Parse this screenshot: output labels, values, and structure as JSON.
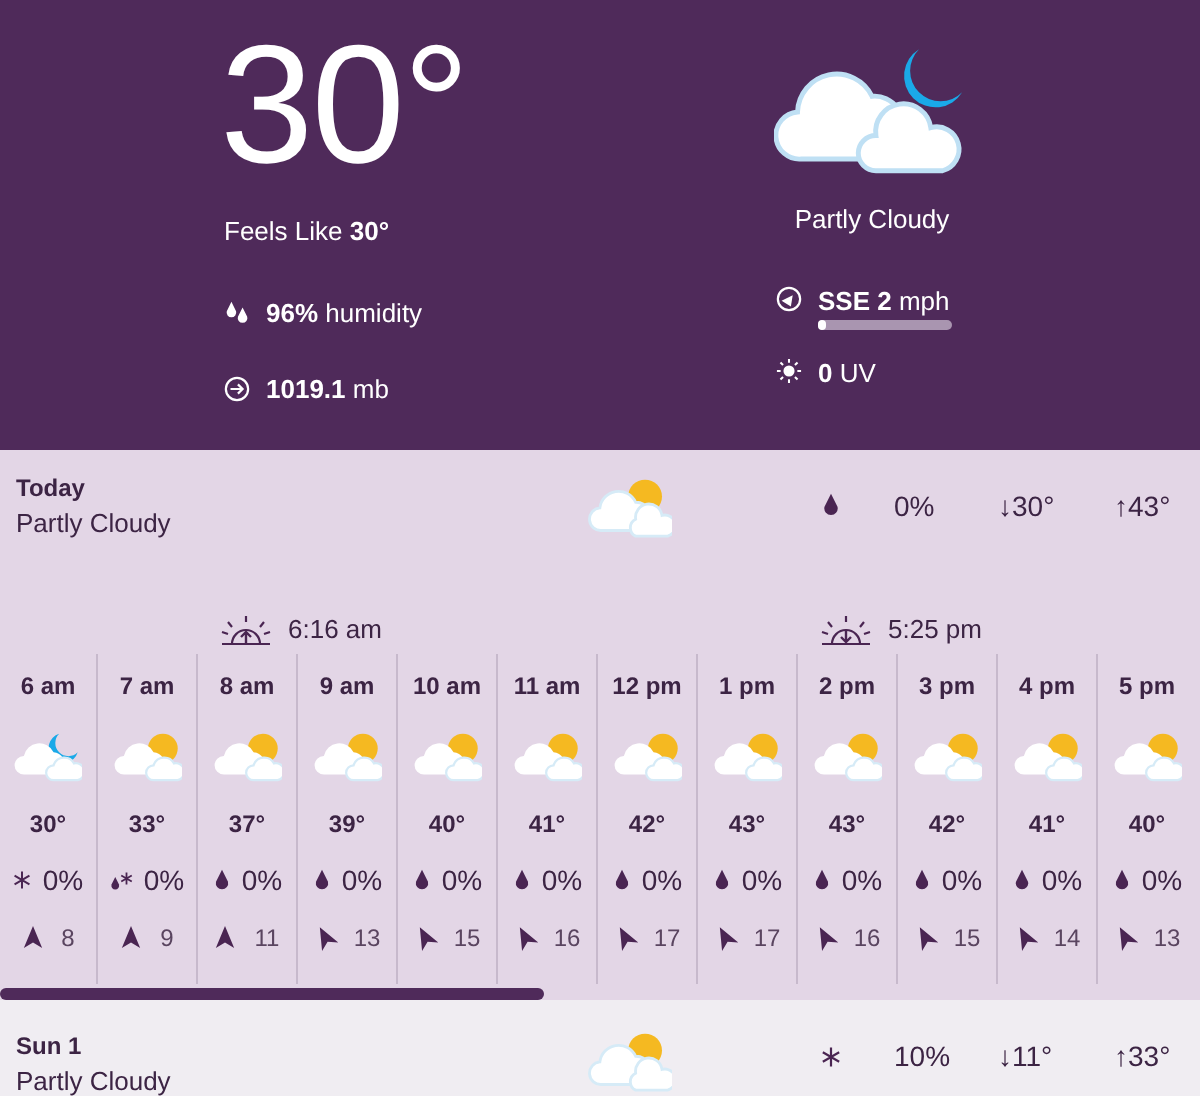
{
  "current": {
    "temperature": "30°",
    "feels_like": "Feels Like **30°**",
    "kind": "night",
    "condition": "Partly Cloudy",
    "humidity": "**96%** humidity",
    "pressure": "**1019.1** mb",
    "wind": {
      "text": "**SSE 2** mph",
      "level": 0.06
    },
    "uv": "**0** UV"
  },
  "today": {
    "name": "Today",
    "condition": "Partly Cloudy",
    "kind": "day",
    "precip": {
      "kind": "rain",
      "value": "0%"
    },
    "low": "↓30°",
    "high": "↑43°",
    "selected": true
  },
  "hourly": [
    {
      "time": "6 am",
      "kind": "night",
      "temp": "30°",
      "precip": {
        "kind": "snow",
        "value": "0%"
      },
      "wind": {
        "kind": "north",
        "value": "8"
      }
    },
    {
      "time": "7 am",
      "kind": "day",
      "temp": "33°",
      "precip": {
        "kind": "sleet",
        "value": "0%"
      },
      "wind": {
        "kind": "north",
        "value": "9"
      }
    },
    {
      "time": "8 am",
      "kind": "day",
      "temp": "37°",
      "precip": {
        "kind": "rain",
        "value": "0%"
      },
      "wind": {
        "kind": "north",
        "value": "11"
      },
      "sun_event": {
        "kind": "sunrise",
        "time": "6:16 am"
      }
    },
    {
      "time": "9 am",
      "kind": "day",
      "temp": "39°",
      "precip": {
        "kind": "rain",
        "value": "0%"
      },
      "wind": {
        "kind": "northwest",
        "value": "13"
      }
    },
    {
      "time": "10 am",
      "kind": "day",
      "temp": "40°",
      "precip": {
        "kind": "rain",
        "value": "0%"
      },
      "wind": {
        "kind": "northwest",
        "value": "15"
      }
    },
    {
      "time": "11 am",
      "kind": "day",
      "temp": "41°",
      "precip": {
        "kind": "rain",
        "value": "0%"
      },
      "wind": {
        "kind": "northwest",
        "value": "16"
      }
    },
    {
      "time": "12 pm",
      "kind": "day",
      "temp": "42°",
      "precip": {
        "kind": "rain",
        "value": "0%"
      },
      "wind": {
        "kind": "northwest",
        "value": "17"
      }
    },
    {
      "time": "1 pm",
      "kind": "day",
      "temp": "43°",
      "precip": {
        "kind": "rain",
        "value": "0%"
      },
      "wind": {
        "kind": "northwest",
        "value": "17"
      }
    },
    {
      "time": "2 pm",
      "kind": "day",
      "temp": "43°",
      "precip": {
        "kind": "rain",
        "value": "0%"
      },
      "wind": {
        "kind": "northwest",
        "value": "16"
      },
      "sun_event": {
        "kind": "sunset",
        "time": "5:25 pm"
      }
    },
    {
      "time": "3 pm",
      "kind": "day",
      "temp": "42°",
      "precip": {
        "kind": "rain",
        "value": "0%"
      },
      "wind": {
        "kind": "northwest",
        "value": "15"
      }
    },
    {
      "time": "4 pm",
      "kind": "day",
      "temp": "41°",
      "precip": {
        "kind": "rain",
        "value": "0%"
      },
      "wind": {
        "kind": "northwest",
        "value": "14"
      }
    },
    {
      "time": "5 pm",
      "kind": "day",
      "temp": "40°",
      "precip": {
        "kind": "rain",
        "value": "0%"
      },
      "wind": {
        "kind": "northwest",
        "value": "13"
      }
    }
  ],
  "next_day": {
    "name": "Sun 1",
    "condition": "Partly Cloudy",
    "kind": "day",
    "precip": {
      "kind": "snow",
      "value": "10%"
    },
    "low": "↓11°",
    "high": "↑33°",
    "selected": false
  }
}
